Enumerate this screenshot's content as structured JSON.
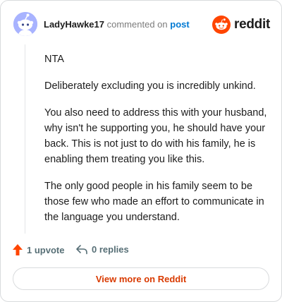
{
  "comment": {
    "author": "LadyHawke17",
    "action_text": "commented on",
    "post_link": "post",
    "paragraphs": [
      "NTA",
      "Deliberately excluding you is incredibly unkind.",
      "You also need to address this with your husband, why isn't he supporting you, he should have your back. This is not just to do with his family, he is enabling them treating you like this.",
      "The only good people in his family seem to be those few who made an effort to communicate in the language you understand."
    ]
  },
  "brand": {
    "logo_text": "reddit",
    "color": "#ff4500"
  },
  "footer": {
    "upvotes": "1 upvote",
    "replies": "0 replies",
    "view_more": "View more on Reddit"
  },
  "icons": {
    "avatar": "snoo-avatar-icon",
    "logo": "reddit-logo-icon",
    "upvote": "upvote-arrow-icon",
    "reply": "reply-arrow-icon"
  }
}
